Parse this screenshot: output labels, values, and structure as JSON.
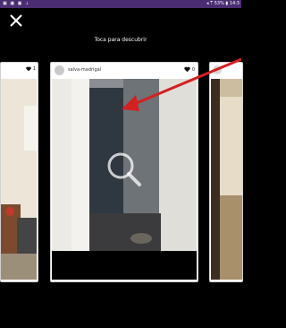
{
  "status_bar": {
    "left_icons": "▣ ▣ ▣ ⊥",
    "right_text": "◂ ⍑ 53% ▮ 14:3"
  },
  "header": {
    "title": "Toca para descubrir"
  },
  "cards": {
    "left": {
      "likes": "1"
    },
    "center": {
      "username": "salva-madrigal",
      "likes": "0"
    }
  },
  "icons": {
    "close": "close-icon",
    "heart": "heart-icon",
    "search": "search-icon"
  },
  "colors": {
    "status_bar": "#4b2d73",
    "arrow": "#d32020"
  }
}
